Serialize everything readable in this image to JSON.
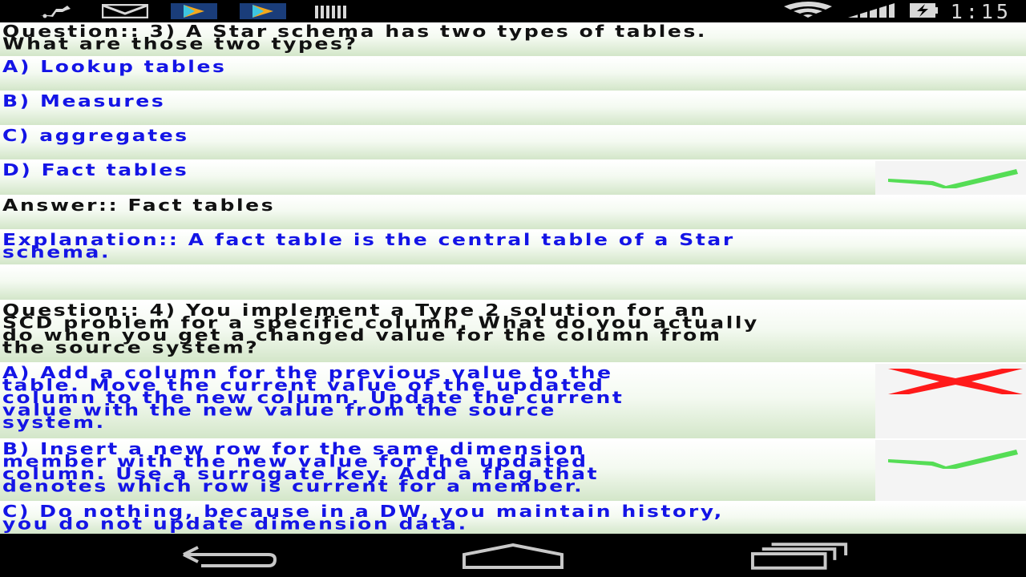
{
  "status_bar": {
    "time": "1:15",
    "icons_left": [
      "usb-icon",
      "gmail-icon",
      "play-store-icon",
      "play-store-icon",
      "barcode-icon"
    ],
    "icons_right": [
      "wifi-icon",
      "signal-icon",
      "battery-charging-icon"
    ]
  },
  "questions": [
    {
      "question_lines": [
        "Question::  3)  A Star schema has two types of tables.",
        "What are those two types?"
      ],
      "options": [
        {
          "lines": [
            "A)  Lookup tables"
          ],
          "mark": null
        },
        {
          "lines": [
            "B)  Measures"
          ],
          "mark": null
        },
        {
          "lines": [
            "C)  aggregates"
          ],
          "mark": null
        },
        {
          "lines": [
            "D)  Fact tables"
          ],
          "mark": "check"
        }
      ],
      "answer": "Answer::  Fact tables",
      "explanation_lines": [
        "Explanation::  A fact table is the central table of a Star",
        "schema."
      ]
    },
    {
      "question_lines": [
        "Question::  4)  You implement a Type 2 solution for an",
        "SCD problem for a specific column. What do you actually",
        "do when you get a changed value for the column from",
        "the source system?"
      ],
      "options": [
        {
          "lines": [
            "A)  Add a column for the previous value to the",
            "table. Move the current value of the updated",
            "column to the new column. Update the current",
            "value with the new value from the source",
            "system."
          ],
          "mark": "cross"
        },
        {
          "lines": [
            "B)  Insert a new row for the same dimension",
            "member with the new value for the updated",
            "column. Use a surrogate key.  Add a flag that",
            "denotes which row is current for a member."
          ],
          "mark": "check"
        },
        {
          "lines": [
            "C)  Do nothing, because in a DW, you maintain history,",
            "you do not update dimension data."
          ],
          "mark": null
        }
      ]
    }
  ],
  "colors": {
    "question_text": "#111111",
    "option_text": "#1414e6",
    "check_mark": "#55dd55",
    "cross_mark": "#ff1a1a",
    "row_gradient_bottom": "#d3e6c9"
  },
  "nav_bar": [
    "back-icon",
    "home-icon",
    "recent-apps-icon"
  ]
}
